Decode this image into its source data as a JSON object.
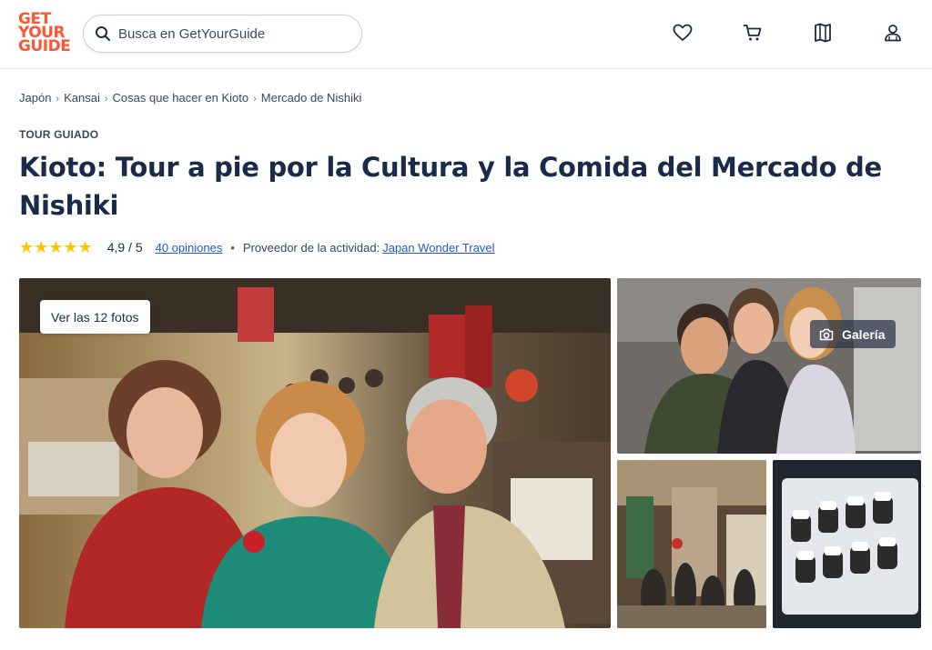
{
  "header": {
    "logo_lines": [
      "GET",
      "YOUR",
      "GUIDE"
    ],
    "search_placeholder": "Busca en GetYourGuide",
    "icons": [
      "heart-icon",
      "cart-icon",
      "map-icon",
      "profile-icon"
    ]
  },
  "breadcrumb": [
    "Japón",
    "Kansai",
    "Cosas que hacer en Kioto",
    "Mercado de Nishiki"
  ],
  "tour_type": "TOUR GUIADO",
  "title": "Kioto: Tour a pie por la Cultura y la Comida del Mercado de Nishiki",
  "rating": {
    "stars": "★★★★★",
    "score": "4,9 / 5",
    "reviews": "40 opiniones",
    "separator": "•",
    "provider_label": "Proveedor de la actividad:",
    "provider_name": "Japan Wonder Travel"
  },
  "gallery": {
    "see_photos": "Ver las 12 fotos",
    "gallery_label": "Galería"
  },
  "colors": {
    "brand": "#ff5533",
    "link": "#1f5ad1",
    "star": "#ffc500",
    "text": "#1a2b49"
  }
}
